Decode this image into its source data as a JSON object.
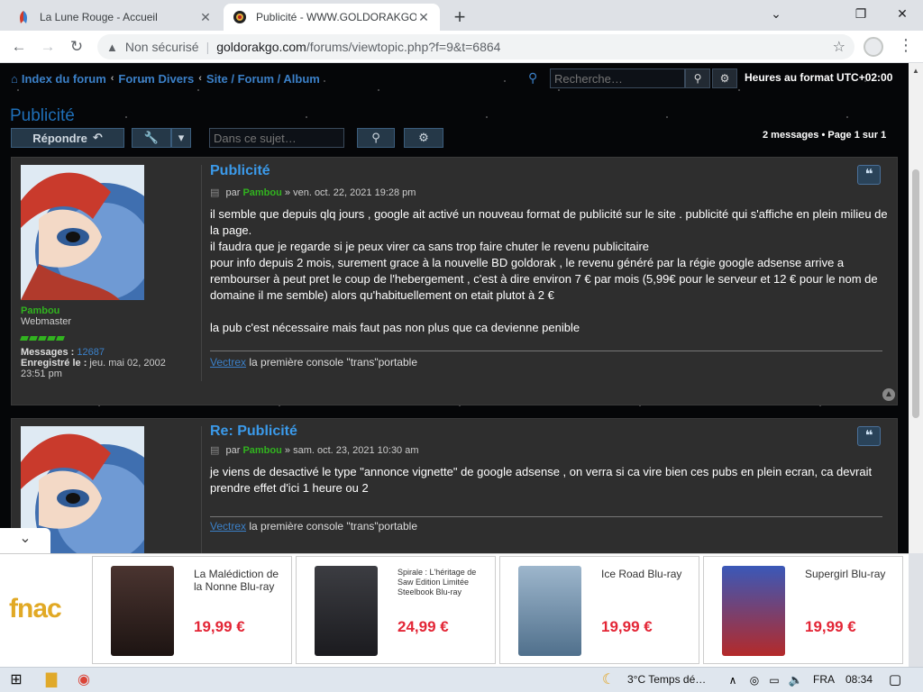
{
  "browser": {
    "tabs": [
      {
        "title": "La Lune Rouge - Accueil",
        "favicon": "lune-rouge-icon"
      },
      {
        "title": "Publicité - WWW.GOLDORAKGO",
        "favicon": "goldorak-icon"
      }
    ],
    "new_tab": "+",
    "window_controls": {
      "minimize": "⌄",
      "maximize": "❐",
      "close": "✕"
    },
    "security_label": "Non sécurisé",
    "url_domain": "goldorakgo.com",
    "url_path": "/forums/viewtopic.php?f=9&t=6864"
  },
  "forum": {
    "breadcrumb": [
      "Index du forum",
      "Forum Divers",
      "Site / Forum / Album"
    ],
    "search_placeholder": "Recherche…",
    "timezone": "Heures au format UTC+02:00",
    "topic_title": "Publicité",
    "reply_label": "Répondre",
    "topic_search_placeholder": "Dans ce sujet…",
    "pagination": {
      "messages": "2 messages",
      "bullet": "•",
      "page_word": "Page",
      "current": "1",
      "of_word": "sur",
      "total": "1"
    }
  },
  "posts": [
    {
      "title": "Publicité",
      "by": "par",
      "author": "Pambou",
      "arrow": "»",
      "date": "ven. oct. 22, 2021 19:28 pm",
      "rank": "Webmaster",
      "messages_label": "Messages :",
      "messages_count": "12687",
      "registered_label": "Enregistré le :",
      "registered_date": "jeu. mai 02, 2002 23:51 pm",
      "body": [
        "il semble que depuis qlq jours , google ait activé un nouveau format de publicité sur le site . publicité qui s'affiche en plein milieu de la page.",
        "il faudra que je regarde si je peux virer ca sans trop faire chuter le revenu publicitaire",
        "pour info depuis 2 mois, surement grace à la nouvelle BD goldorak , le revenu généré par la régie google adsense arrive a rembourser à peut pret le coup de l'hebergement , c'est à dire environ 7 € par mois (5,99€ pour le serveur et 12 € pour le nom de domaine il me semble) alors qu'habituellement on etait plutot à 2 €",
        "",
        "la pub c'est nécessaire mais faut pas non plus que ca devienne penible"
      ],
      "sig_link": "Vectrex",
      "sig_text": "la première console \"trans\"portable"
    },
    {
      "title": "Re: Publicité",
      "by": "par",
      "author": "Pambou",
      "arrow": "»",
      "date": "sam. oct. 23, 2021 10:30 am",
      "body": [
        "je viens de desactivé le type \"annonce vignette\" de google adsense , on verra si ca vire bien ces pubs en plein ecran, ca devrait prendre effet d'ici 1 heure ou 2"
      ],
      "sig_link": "Vectrex",
      "sig_text": "la première console \"trans\"portable"
    }
  ],
  "ad": {
    "brand": "fnac",
    "products": [
      {
        "title": "La Malédiction de la Nonne Blu-ray",
        "price": "19,99 €",
        "cover_color": "#3a2a28"
      },
      {
        "title": "Spirale : L'héritage de Saw Edition Limitée Steelbook Blu-ray",
        "price": "24,99 €",
        "cover_color": "#2b2c30"
      },
      {
        "title": "Ice Road Blu-ray",
        "price": "19,99 €",
        "cover_color": "#6d8ca8"
      },
      {
        "title": "Supergirl Blu-ray",
        "price": "19,99 €",
        "cover_color": "#243a8a"
      }
    ]
  },
  "taskbar": {
    "weather": "3°C  Temps dé…",
    "language": "FRA",
    "time": "08:34"
  },
  "colors": {
    "link": "#3b80c8",
    "username": "#31b31f",
    "price": "#e32636",
    "fnac": "#e1a925"
  }
}
